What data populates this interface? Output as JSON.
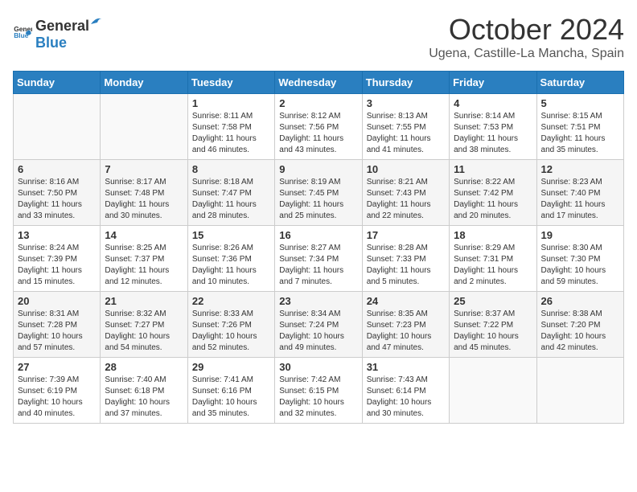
{
  "header": {
    "logo_general": "General",
    "logo_blue": "Blue",
    "month": "October 2024",
    "location": "Ugena, Castille-La Mancha, Spain"
  },
  "weekdays": [
    "Sunday",
    "Monday",
    "Tuesday",
    "Wednesday",
    "Thursday",
    "Friday",
    "Saturday"
  ],
  "weeks": [
    [
      {
        "day": "",
        "sunrise": "",
        "sunset": "",
        "daylight": ""
      },
      {
        "day": "",
        "sunrise": "",
        "sunset": "",
        "daylight": ""
      },
      {
        "day": "1",
        "sunrise": "Sunrise: 8:11 AM",
        "sunset": "Sunset: 7:58 PM",
        "daylight": "Daylight: 11 hours and 46 minutes."
      },
      {
        "day": "2",
        "sunrise": "Sunrise: 8:12 AM",
        "sunset": "Sunset: 7:56 PM",
        "daylight": "Daylight: 11 hours and 43 minutes."
      },
      {
        "day": "3",
        "sunrise": "Sunrise: 8:13 AM",
        "sunset": "Sunset: 7:55 PM",
        "daylight": "Daylight: 11 hours and 41 minutes."
      },
      {
        "day": "4",
        "sunrise": "Sunrise: 8:14 AM",
        "sunset": "Sunset: 7:53 PM",
        "daylight": "Daylight: 11 hours and 38 minutes."
      },
      {
        "day": "5",
        "sunrise": "Sunrise: 8:15 AM",
        "sunset": "Sunset: 7:51 PM",
        "daylight": "Daylight: 11 hours and 35 minutes."
      }
    ],
    [
      {
        "day": "6",
        "sunrise": "Sunrise: 8:16 AM",
        "sunset": "Sunset: 7:50 PM",
        "daylight": "Daylight: 11 hours and 33 minutes."
      },
      {
        "day": "7",
        "sunrise": "Sunrise: 8:17 AM",
        "sunset": "Sunset: 7:48 PM",
        "daylight": "Daylight: 11 hours and 30 minutes."
      },
      {
        "day": "8",
        "sunrise": "Sunrise: 8:18 AM",
        "sunset": "Sunset: 7:47 PM",
        "daylight": "Daylight: 11 hours and 28 minutes."
      },
      {
        "day": "9",
        "sunrise": "Sunrise: 8:19 AM",
        "sunset": "Sunset: 7:45 PM",
        "daylight": "Daylight: 11 hours and 25 minutes."
      },
      {
        "day": "10",
        "sunrise": "Sunrise: 8:21 AM",
        "sunset": "Sunset: 7:43 PM",
        "daylight": "Daylight: 11 hours and 22 minutes."
      },
      {
        "day": "11",
        "sunrise": "Sunrise: 8:22 AM",
        "sunset": "Sunset: 7:42 PM",
        "daylight": "Daylight: 11 hours and 20 minutes."
      },
      {
        "day": "12",
        "sunrise": "Sunrise: 8:23 AM",
        "sunset": "Sunset: 7:40 PM",
        "daylight": "Daylight: 11 hours and 17 minutes."
      }
    ],
    [
      {
        "day": "13",
        "sunrise": "Sunrise: 8:24 AM",
        "sunset": "Sunset: 7:39 PM",
        "daylight": "Daylight: 11 hours and 15 minutes."
      },
      {
        "day": "14",
        "sunrise": "Sunrise: 8:25 AM",
        "sunset": "Sunset: 7:37 PM",
        "daylight": "Daylight: 11 hours and 12 minutes."
      },
      {
        "day": "15",
        "sunrise": "Sunrise: 8:26 AM",
        "sunset": "Sunset: 7:36 PM",
        "daylight": "Daylight: 11 hours and 10 minutes."
      },
      {
        "day": "16",
        "sunrise": "Sunrise: 8:27 AM",
        "sunset": "Sunset: 7:34 PM",
        "daylight": "Daylight: 11 hours and 7 minutes."
      },
      {
        "day": "17",
        "sunrise": "Sunrise: 8:28 AM",
        "sunset": "Sunset: 7:33 PM",
        "daylight": "Daylight: 11 hours and 5 minutes."
      },
      {
        "day": "18",
        "sunrise": "Sunrise: 8:29 AM",
        "sunset": "Sunset: 7:31 PM",
        "daylight": "Daylight: 11 hours and 2 minutes."
      },
      {
        "day": "19",
        "sunrise": "Sunrise: 8:30 AM",
        "sunset": "Sunset: 7:30 PM",
        "daylight": "Daylight: 10 hours and 59 minutes."
      }
    ],
    [
      {
        "day": "20",
        "sunrise": "Sunrise: 8:31 AM",
        "sunset": "Sunset: 7:28 PM",
        "daylight": "Daylight: 10 hours and 57 minutes."
      },
      {
        "day": "21",
        "sunrise": "Sunrise: 8:32 AM",
        "sunset": "Sunset: 7:27 PM",
        "daylight": "Daylight: 10 hours and 54 minutes."
      },
      {
        "day": "22",
        "sunrise": "Sunrise: 8:33 AM",
        "sunset": "Sunset: 7:26 PM",
        "daylight": "Daylight: 10 hours and 52 minutes."
      },
      {
        "day": "23",
        "sunrise": "Sunrise: 8:34 AM",
        "sunset": "Sunset: 7:24 PM",
        "daylight": "Daylight: 10 hours and 49 minutes."
      },
      {
        "day": "24",
        "sunrise": "Sunrise: 8:35 AM",
        "sunset": "Sunset: 7:23 PM",
        "daylight": "Daylight: 10 hours and 47 minutes."
      },
      {
        "day": "25",
        "sunrise": "Sunrise: 8:37 AM",
        "sunset": "Sunset: 7:22 PM",
        "daylight": "Daylight: 10 hours and 45 minutes."
      },
      {
        "day": "26",
        "sunrise": "Sunrise: 8:38 AM",
        "sunset": "Sunset: 7:20 PM",
        "daylight": "Daylight: 10 hours and 42 minutes."
      }
    ],
    [
      {
        "day": "27",
        "sunrise": "Sunrise: 7:39 AM",
        "sunset": "Sunset: 6:19 PM",
        "daylight": "Daylight: 10 hours and 40 minutes."
      },
      {
        "day": "28",
        "sunrise": "Sunrise: 7:40 AM",
        "sunset": "Sunset: 6:18 PM",
        "daylight": "Daylight: 10 hours and 37 minutes."
      },
      {
        "day": "29",
        "sunrise": "Sunrise: 7:41 AM",
        "sunset": "Sunset: 6:16 PM",
        "daylight": "Daylight: 10 hours and 35 minutes."
      },
      {
        "day": "30",
        "sunrise": "Sunrise: 7:42 AM",
        "sunset": "Sunset: 6:15 PM",
        "daylight": "Daylight: 10 hours and 32 minutes."
      },
      {
        "day": "31",
        "sunrise": "Sunrise: 7:43 AM",
        "sunset": "Sunset: 6:14 PM",
        "daylight": "Daylight: 10 hours and 30 minutes."
      },
      {
        "day": "",
        "sunrise": "",
        "sunset": "",
        "daylight": ""
      },
      {
        "day": "",
        "sunrise": "",
        "sunset": "",
        "daylight": ""
      }
    ]
  ]
}
